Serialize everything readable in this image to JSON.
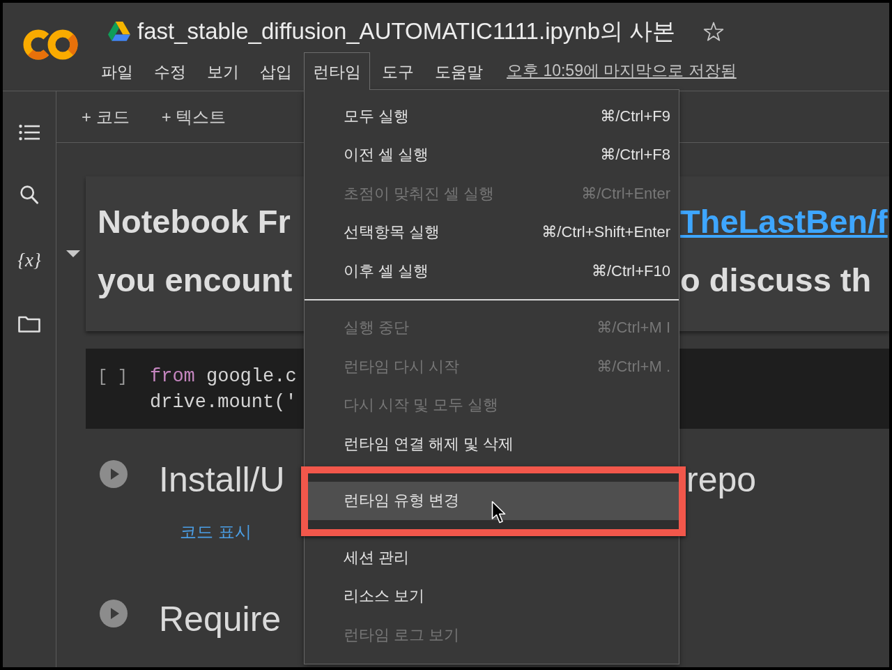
{
  "header": {
    "title": "fast_stable_diffusion_AUTOMATIC1111.ipynb의 사본",
    "starred": false,
    "menus": [
      {
        "label": "파일",
        "selected": false
      },
      {
        "label": "수정",
        "selected": false
      },
      {
        "label": "보기",
        "selected": false
      },
      {
        "label": "삽입",
        "selected": false
      },
      {
        "label": "런타임",
        "selected": true
      },
      {
        "label": "도구",
        "selected": false
      },
      {
        "label": "도움말",
        "selected": false
      }
    ],
    "save_status": "오후 10:59에 마지막으로 저장됨"
  },
  "sidebar": {
    "symbol_button": "{x}"
  },
  "toolbar": {
    "buttons": [
      "+ 코드",
      "+ 텍스트"
    ]
  },
  "notebook": {
    "text_cell": {
      "expanded": true,
      "lines": [
        {
          "left": "Notebook Fr",
          "right": "TheLastBen/f",
          "right_linked": true
        },
        {
          "left": "you encount",
          "right": "o discuss th",
          "right_linked": false
        }
      ]
    },
    "code_cell": {
      "run_label": "[ ]",
      "lines": [
        [
          {
            "kind": "keyword",
            "text": "from"
          },
          {
            "kind": "plain",
            "text": " google.c"
          }
        ],
        [
          {
            "kind": "plain",
            "text": "drive.mount('"
          }
        ]
      ]
    },
    "sections": [
      {
        "title_left": "Install/U",
        "title_right": "repo",
        "link": "코드 표시"
      },
      {
        "title_left": "Require"
      }
    ]
  },
  "runtime_menu": {
    "groups": [
      {
        "items": [
          {
            "label": "모두 실행",
            "shortcut": "⌘/Ctrl+F9",
            "disabled": false,
            "hovered": false,
            "highlighted": false
          },
          {
            "label": "이전 셀 실행",
            "shortcut": "⌘/Ctrl+F8",
            "disabled": false,
            "hovered": false,
            "highlighted": false
          },
          {
            "label": "초점이 맞춰진 셀 실행",
            "shortcut": "⌘/Ctrl+Enter",
            "disabled": true,
            "hovered": false,
            "highlighted": false
          },
          {
            "label": "선택항목 실행",
            "shortcut": "⌘/Ctrl+Shift+Enter",
            "disabled": false,
            "hovered": false,
            "highlighted": false
          },
          {
            "label": "이후 셀 실행",
            "shortcut": "⌘/Ctrl+F10",
            "disabled": false,
            "hovered": false,
            "highlighted": false
          }
        ]
      },
      {
        "items": [
          {
            "label": "실행 중단",
            "shortcut": "⌘/Ctrl+M I",
            "disabled": true,
            "hovered": false,
            "highlighted": false
          },
          {
            "label": "런타임 다시 시작",
            "shortcut": "⌘/Ctrl+M .",
            "disabled": true,
            "hovered": false,
            "highlighted": false
          },
          {
            "label": "다시 시작 및 모두 실행",
            "disabled": true,
            "hovered": false,
            "highlighted": false
          },
          {
            "label": "런타임 연결 해제 및 삭제",
            "disabled": false,
            "hovered": false,
            "highlighted": false
          }
        ]
      },
      {
        "items": [
          {
            "label": "런타임 유형 변경",
            "disabled": false,
            "hovered": true,
            "highlighted": true
          }
        ]
      },
      {
        "items": [
          {
            "label": "세션 관리",
            "disabled": false,
            "hovered": false,
            "highlighted": false
          },
          {
            "label": "리소스 보기",
            "disabled": false,
            "hovered": false,
            "highlighted": false
          },
          {
            "label": "런타임 로그 보기",
            "disabled": true,
            "hovered": false,
            "highlighted": false
          }
        ]
      }
    ]
  }
}
